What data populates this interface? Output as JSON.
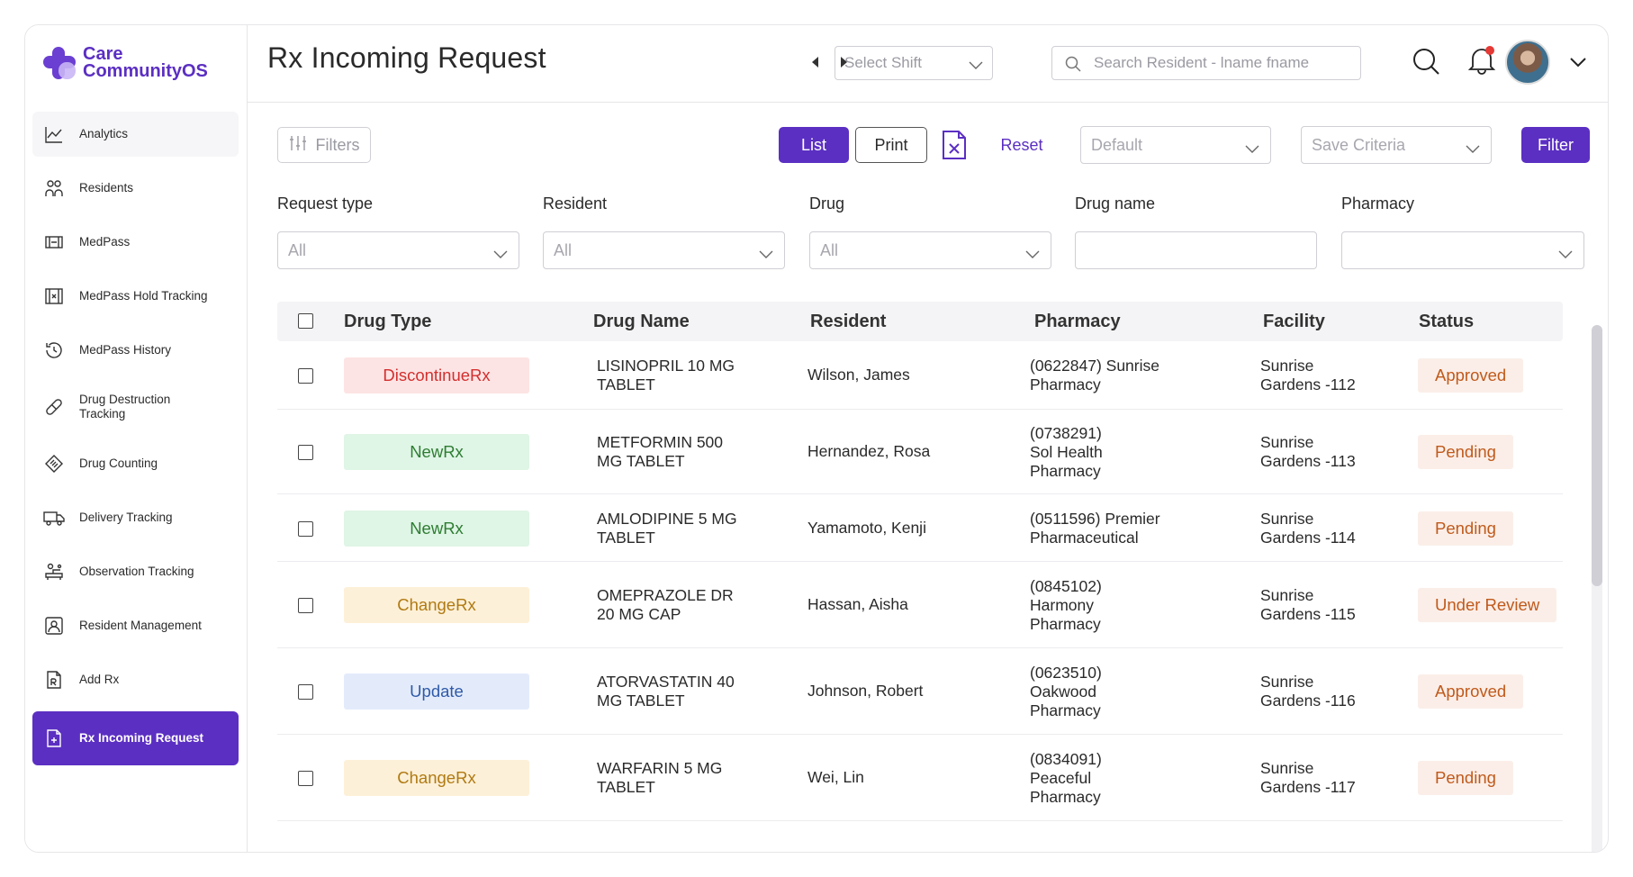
{
  "app": {
    "logo_line1": "Care",
    "logo_line2": "CommunityOS"
  },
  "sidebar": {
    "items": [
      {
        "label": "Analytics",
        "icon": "line-chart-icon"
      },
      {
        "label": "Residents",
        "icon": "people-icon"
      },
      {
        "label": "MedPass",
        "icon": "medpass-icon"
      },
      {
        "label": "MedPass Hold Tracking",
        "icon": "hold-tracking-icon"
      },
      {
        "label": "MedPass History",
        "icon": "history-icon"
      },
      {
        "label": "Drug Destruction Tracking",
        "icon": "pill-icon"
      },
      {
        "label": "Drug Counting",
        "icon": "tag-icon"
      },
      {
        "label": "Delivery Tracking",
        "icon": "truck-icon"
      },
      {
        "label": "Observation Tracking",
        "icon": "observation-icon"
      },
      {
        "label": "Resident Management",
        "icon": "resident-card-icon"
      },
      {
        "label": "Add Rx",
        "icon": "rx-document-icon"
      },
      {
        "label": "Rx Incoming Request",
        "icon": "request-document-icon",
        "active": true
      }
    ]
  },
  "header": {
    "title": "Rx Incoming Request",
    "shift_placeholder": "Select Shift",
    "search_placeholder": "Search Resident - lname fname"
  },
  "toolbar": {
    "filters_label": "Filters",
    "list_label": "List",
    "print_label": "Print",
    "reset_label": "Reset",
    "default_value": "Default",
    "save_criteria_placeholder": "Save Criteria",
    "filter_label": "Filter"
  },
  "filters": {
    "request_type": {
      "label": "Request type",
      "value": "All"
    },
    "resident": {
      "label": "Resident",
      "value": "All"
    },
    "drug": {
      "label": "Drug",
      "value": "All"
    },
    "drug_name": {
      "label": "Drug name",
      "value": ""
    },
    "pharmacy": {
      "label": "Pharmacy",
      "value": ""
    }
  },
  "table": {
    "columns": [
      "Drug Type",
      "Drug Name",
      "Resident",
      "Pharmacy",
      "Facility",
      "Status"
    ],
    "rows": [
      {
        "drug_type": "DiscontinueRx",
        "drug_name": "LISINOPRIL 10 MG TABLET",
        "resident": "Wilson, James",
        "pharmacy": "(0622847) Sunrise Pharmacy",
        "facility": "Sunrise Gardens -112",
        "status": "Approved"
      },
      {
        "drug_type": "NewRx",
        "drug_name": "METFORMIN 500 MG TABLET",
        "resident": "Hernandez, Rosa",
        "pharmacy": "(0738291) Sol Health Pharmacy",
        "facility": "Sunrise Gardens -113",
        "status": "Pending"
      },
      {
        "drug_type": "NewRx",
        "drug_name": "AMLODIPINE 5 MG TABLET",
        "resident": "Yamamoto, Kenji",
        "pharmacy": "(0511596) Premier Pharmaceutical",
        "facility": "Sunrise Gardens -114",
        "status": "Pending"
      },
      {
        "drug_type": "ChangeRx",
        "drug_name": "OMEPRAZOLE DR 20 MG CAP",
        "resident": "Hassan, Aisha",
        "pharmacy": "(0845102) Harmony Pharmacy",
        "facility": "Sunrise Gardens -115",
        "status": "Under Review"
      },
      {
        "drug_type": "Update",
        "drug_name": "ATORVASTATIN 40 MG TABLET",
        "resident": "Johnson, Robert",
        "pharmacy": "(0623510) Oakwood Pharmacy",
        "facility": "Sunrise Gardens -116",
        "status": "Approved"
      },
      {
        "drug_type": "ChangeRx",
        "drug_name": "WARFARIN 5 MG TABLET",
        "resident": "Wei, Lin",
        "pharmacy": "(0834091) Peaceful Pharmacy",
        "facility": "Sunrise Gardens -117",
        "status": "Pending"
      }
    ]
  },
  "colors": {
    "brand": "#5b2fc2",
    "DiscontinueRx": {
      "bg": "#fde4e4",
      "fg": "#d32f2f"
    },
    "NewRx": {
      "bg": "#dff5e6",
      "fg": "#2e7d32"
    },
    "ChangeRx": {
      "bg": "#fdf0d8",
      "fg": "#b07a12"
    },
    "Update": {
      "bg": "#e3ebfb",
      "fg": "#2f5aa8"
    },
    "status_text": "#c05a1b"
  }
}
